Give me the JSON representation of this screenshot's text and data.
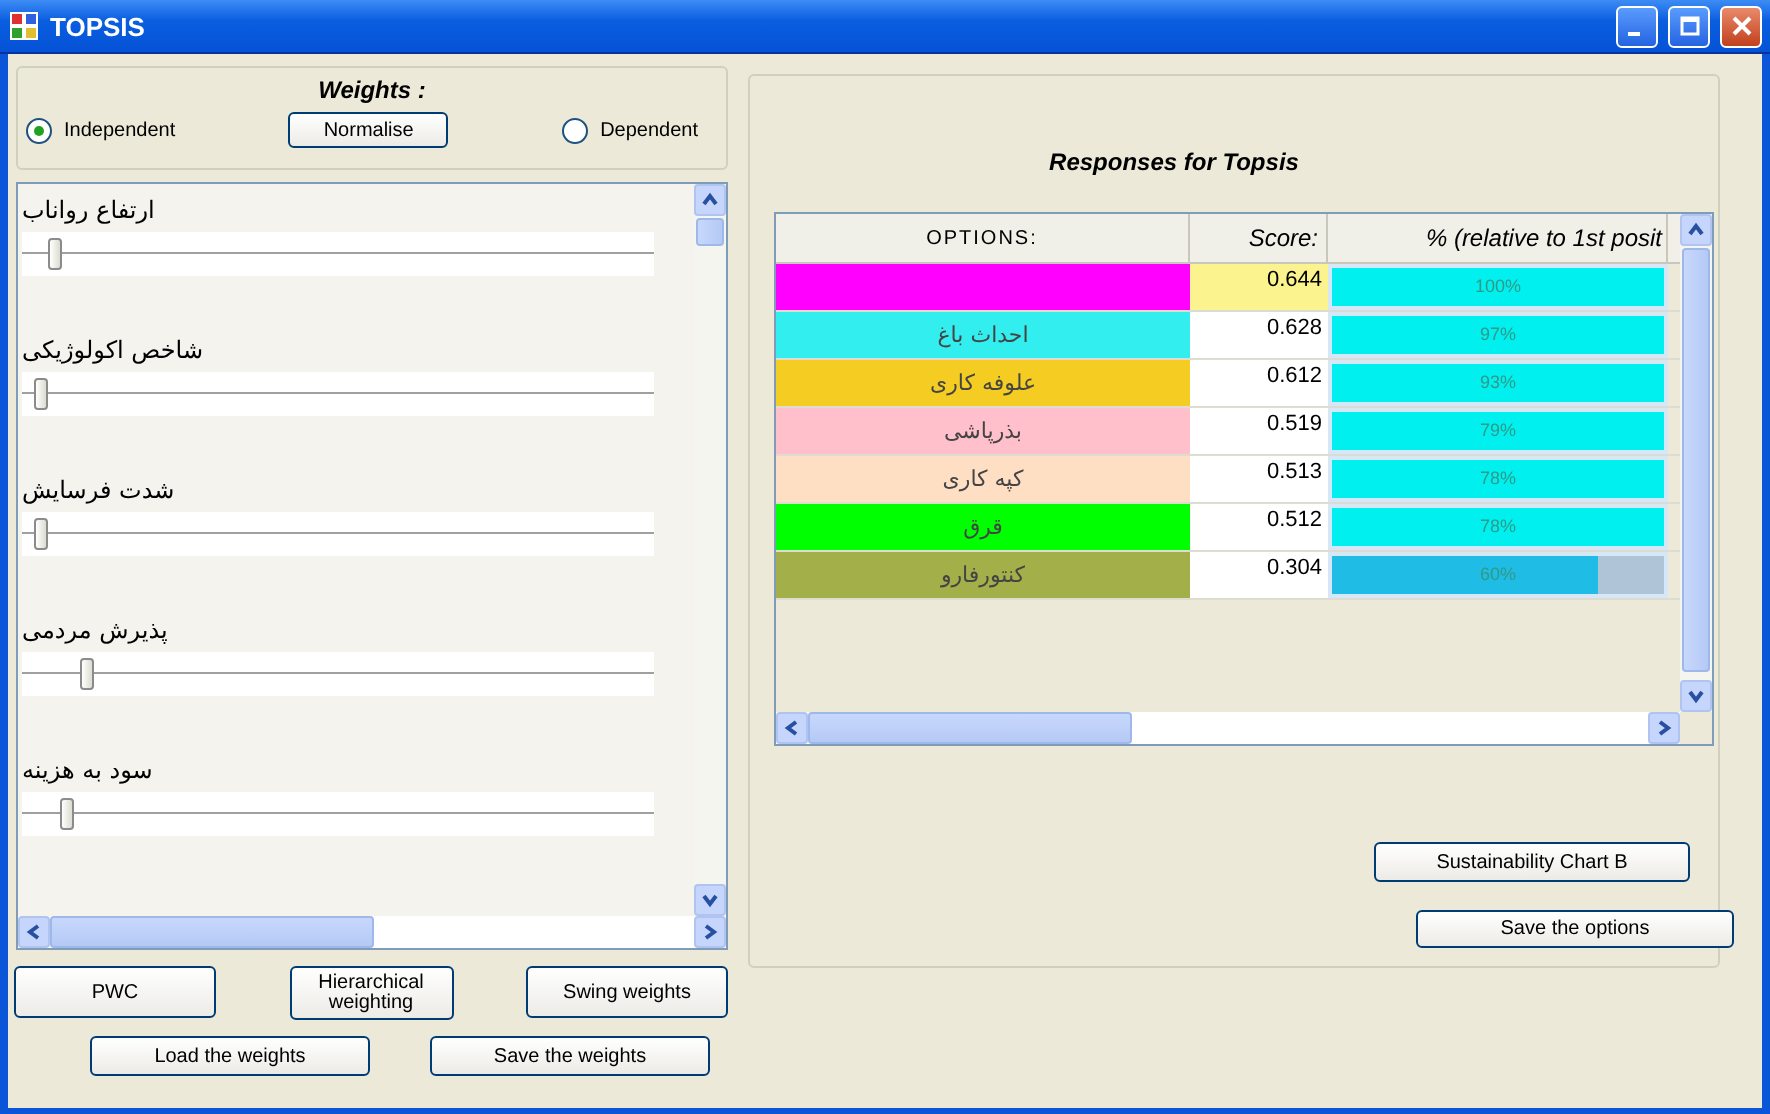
{
  "window": {
    "title": "TOPSIS"
  },
  "weights": {
    "title": "Weights :",
    "modes": [
      {
        "label": "Independent",
        "selected": true
      },
      {
        "label": "Dependent",
        "selected": false
      }
    ],
    "normalise_button": "Normalise",
    "sliders": [
      {
        "label": "ارتفاع رواناب",
        "level": 0.05
      },
      {
        "label": "شاخص اکولوژیکی",
        "level": 0.03
      },
      {
        "label": "شدت فرسایش",
        "level": 0.03
      },
      {
        "label": "پذیرش مردمی",
        "level": 0.1
      },
      {
        "label": "سود به هزینه",
        "level": 0.07
      }
    ],
    "buttons": [
      "PWC",
      "Hierarchical weighting",
      "Swing weights"
    ],
    "bottom_buttons": [
      "Load the weights",
      "Save the weights"
    ]
  },
  "responses": {
    "title": "Responses for Topsis",
    "columns": [
      "OPTIONS:",
      "Score:",
      "% (relative to 1st posit"
    ],
    "rows": [
      {
        "color": "#ff00ff",
        "score": "0.644",
        "percent": "100%",
        "level": 1,
        "selected": true
      },
      {
        "name": "احداث باغ",
        "color": "#33eeee",
        "score": "0.628",
        "percent": "97%",
        "level": 1,
        "selected": false
      },
      {
        "name": "علوفه کاری",
        "color": "#f5cc22",
        "score": "0.612",
        "percent": "93%",
        "level": 1,
        "selected": false
      },
      {
        "name": "بذرپاشی",
        "color": "#ffc0cb",
        "score": "0.519",
        "percent": "79%",
        "level": 1,
        "selected": false
      },
      {
        "name": "کپه کاری",
        "color": "#ffdfc4",
        "score": "0.513",
        "percent": "78%",
        "level": 1,
        "selected": false
      },
      {
        "name": "قرق",
        "color": "#00ff00",
        "score": "0.512",
        "percent": "78%",
        "level": 1,
        "selected": false
      },
      {
        "name": "کنتورفارو",
        "color": "#a3b04a",
        "score": "0.304",
        "percent": "60%",
        "level": 0.8,
        "selected": false
      }
    ],
    "buttons": [
      "Sustainability Chart B",
      "Save the options"
    ]
  }
}
